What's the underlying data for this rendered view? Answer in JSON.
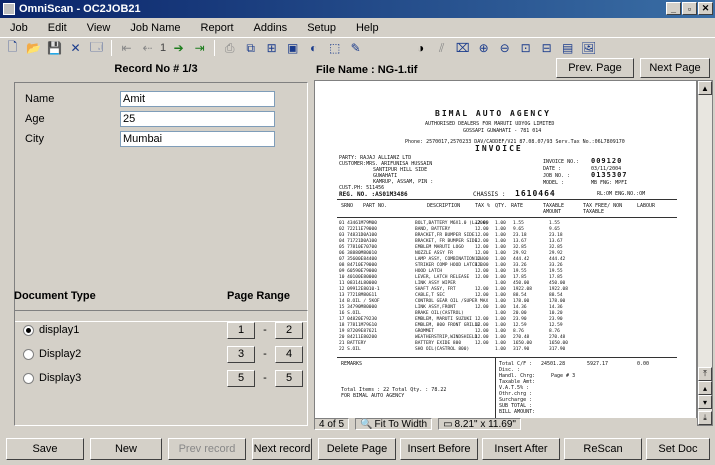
{
  "window": {
    "title": "OmniScan - OC2JOB21",
    "min": "_",
    "max": "▫",
    "close": "✕"
  },
  "menu": [
    "Job",
    "Edit",
    "View",
    "Job Name",
    "Report",
    "Addins",
    "Setup",
    "Help"
  ],
  "toolbar": {
    "page_value": "1"
  },
  "record": {
    "header": "Record No # 1/3"
  },
  "form": {
    "name_label": "Name",
    "name_value": "Amit",
    "age_label": "Age",
    "age_value": "25",
    "city_label": "City",
    "city_value": "Mumbai"
  },
  "documents": {
    "type_header": "Document Type",
    "range_header": "Page Range",
    "items": [
      {
        "label": "display1",
        "from": "1",
        "to": "2",
        "checked": true
      },
      {
        "label": "Display2",
        "from": "3",
        "to": "4",
        "checked": false
      },
      {
        "label": "Display3",
        "from": "5",
        "to": "5",
        "checked": false
      }
    ],
    "sep": "-"
  },
  "viewer": {
    "file_label": "File Name : NG-1.tif",
    "prev_page": "Prev. Page",
    "next_page": "Next Page",
    "page_count": "4 of 5",
    "fit": "Fit To Width",
    "size": "8.21\" x 11.69\""
  },
  "invoice": {
    "company": "BIMAL  AUTO  AGENCY",
    "subtitle": "AUTHORISED DEALERS FOR MARUTI UDYOG LIMITED",
    "address": "GOSSAPI GUWAHATI - 781 014",
    "doc_title": "INVOICE",
    "phone_line": "Phone: 2570017,2570233  DAV/CADDEF/V21 87.08.07/93  Serv.Tax No.:06L7809170",
    "party": "PARTY: RAJAJ ALLIANZ LTD",
    "customer": "CUSTOMER:MRS. ARIFUNISA HUSSAIN",
    "addr1": "SANTIPUR HILL SIDE",
    "addr2": "GUWAHATI",
    "addr3": "KAMRUP, ASSAM, PIN :",
    "cust_ph": "CUST.PH: 511456",
    "reg_no": "REG. NO. :AS01M3486",
    "chassis": "CHASSIS :",
    "chassis_no": "1610464",
    "eng": "RL:OM ENG.NO.:OM",
    "invoice_no_label": "INVOICE NO.:",
    "invoice_no": "009120",
    "date_label": "DATE      :",
    "date": "03/11/2004",
    "job_no_label": "JOB NO.   :",
    "job_no": "0135307",
    "model_label": "MODEL     :",
    "model": "MB FNG: MPFI",
    "col_srno": "SRNO",
    "col_part": "PART NO.",
    "col_desc": "DESCRIPTION",
    "col_tax": "TAX %",
    "col_qty": "QTY.",
    "col_rate": "RATE",
    "col_taxable": "TAXABLE AMOUNT",
    "col_taxfree": "TAX FREE/ NON TAXABLE",
    "col_labour": "LABOUR",
    "rows": [
      [
        "01 43461M79M00",
        "BOLT,BATTERY M6X1.0 (L=200)",
        "12.00",
        "1.00",
        "1.55",
        "1.55"
      ],
      [
        "02 72211E79000",
        "BAND, BATTERY",
        "12.00",
        "1.00",
        "9.65",
        "9.65"
      ],
      [
        "03 74831D0A100",
        "BRACKET,FR BUMPER SIDE",
        "12.00",
        "1.00",
        "23.18",
        "23.18"
      ],
      [
        "04 71721D0A100",
        "BRACKET, FR BUMPER SIDE",
        "12.00",
        "1.00",
        "13.67",
        "13.67"
      ],
      [
        "05 77810E70700",
        "EMBLEM MARUTI LOGO",
        "12.00",
        "1.00",
        "32.85",
        "32.85"
      ],
      [
        "06 38880M80010",
        "NOZZLE ASSY FR",
        "12.00",
        "1.00",
        "29.92",
        "29.92"
      ],
      [
        "07 35600E84400",
        "LAMP ASSY, COMBINATION LH",
        "12.00",
        "1.00",
        "444.42",
        "444.42"
      ],
      [
        "08 84710E79000",
        "STRIKER COMP HOOD LATCH B",
        "12.00",
        "1.00",
        "33.26",
        "33.26"
      ],
      [
        "09 60590E79000",
        "HOOD LATCH",
        "12.00",
        "1.00",
        "19.55",
        "19.55"
      ],
      [
        "10 40100E80000",
        "LEVER, LATCH RELEASE",
        "12.00",
        "1.00",
        "17.85",
        "17.85"
      ],
      [
        "11 08314L80000",
        "LINK ASSY WIPER",
        "",
        "1.00",
        "450.00",
        "450.00"
      ],
      [
        "12 09912E8010-1",
        "SHAFT ASSY, FRT",
        "12.00",
        "1.00",
        "1922.08",
        "1922.08"
      ],
      [
        "13 77218M80G11",
        "CABLE,T SEC",
        "12.00",
        "1.00",
        "88.54",
        "88.54"
      ],
      [
        "14 B.OIL / 5KOF",
        "CONTROL GEAR OIL /SUPER MAX",
        "",
        "1.00",
        "178.00",
        "178.00"
      ],
      [
        "15 34790M80000",
        "LINK ASSY,FRONT",
        "12.00",
        "1.00",
        "14.36",
        "14.36"
      ],
      [
        "16 S.OIL",
        "BRAKE OIL(CASTROL)",
        "",
        "1.00",
        "20.00",
        "10.20"
      ],
      [
        "17 04820E79230",
        "EMBLEM, MARUTI SUZUKI",
        "12.00",
        "1.00",
        "23.90",
        "23.90"
      ],
      [
        "18 77811M79G10",
        "EMBLEM, 800 FRONT GRILLE",
        "12.00",
        "1.00",
        "12.59",
        "12.59"
      ],
      [
        "19 87209E87621",
        "GROMMET",
        "12.00",
        "1.00",
        "8.76",
        "8.76"
      ],
      [
        "20 84211E80200",
        "WEATHERSTRIP,WINDSHIELD",
        "12.00",
        "1.00",
        "270.48",
        "270.48"
      ],
      [
        "21 BATTERY",
        "BATTERY EXIDE 800",
        "12.00",
        "1.00",
        "1650.00",
        "1650.00"
      ],
      [
        "22 S.OIL",
        "SHO OIL(CASTROL 800)",
        "",
        "1.00",
        "317.90",
        "317.90"
      ]
    ],
    "remarks": "REMARKS",
    "total_label": "Total C/F :",
    "total_val": "24501.28",
    "total_val2": "5927.17",
    "total_val3": "0.00",
    "disc": "Disc.     :",
    "handl": "Handl. Chrg:",
    "page_ref": "Page # 3",
    "taxable_amt": "Taxable Amt:",
    "vat": "V.A.T.5%  :",
    "other": "Othr.chrg :",
    "surcharge": "Surcharge :",
    "subtotal": "SUB TOTAL :",
    "bill_amount": "BILL AMOUNT:",
    "total_items": "Total Items : 22     Total Qty. :   78.22",
    "for_line": "FOR BIMAL AUTO AGENCY"
  },
  "bottom": {
    "save": "Save",
    "new": "New",
    "prev_record": "Prev record",
    "next_record": "Next record",
    "delete_page": "Delete Page",
    "insert_before": "Insert Before",
    "insert_after": "Insert After",
    "rescan": "ReScan",
    "set_doc": "Set Doc"
  }
}
